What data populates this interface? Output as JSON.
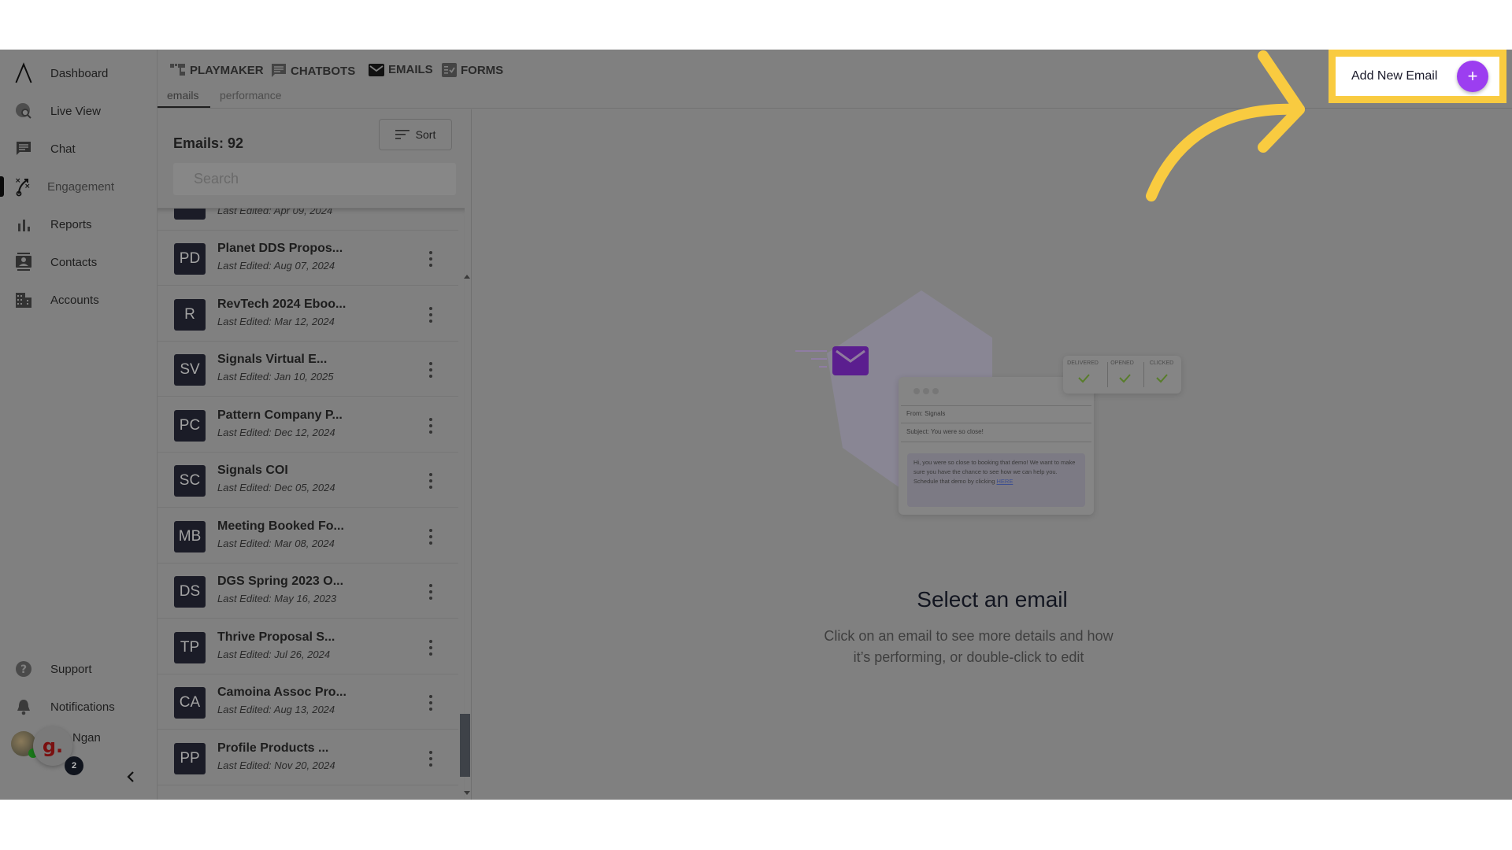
{
  "sidebar": {
    "items": [
      {
        "label": "Dashboard",
        "icon": "logo-icon"
      },
      {
        "label": "Live View",
        "icon": "globe-search-icon"
      },
      {
        "label": "Chat",
        "icon": "chat-icon"
      },
      {
        "label": "Engagement",
        "icon": "playbook-icon",
        "active": true
      },
      {
        "label": "Reports",
        "icon": "bar-chart-icon"
      },
      {
        "label": "Contacts",
        "icon": "contact-card-icon"
      },
      {
        "label": "Accounts",
        "icon": "building-icon"
      }
    ],
    "bottom_items": [
      {
        "label": "Support",
        "icon": "help-icon"
      },
      {
        "label": "Notifications",
        "icon": "bell-icon"
      }
    ],
    "user": {
      "name": "Ngan",
      "bubble_letter": "g.",
      "notification_count": "2"
    },
    "collapse_icon": "chevron-left-icon"
  },
  "topnav": {
    "tools": [
      {
        "label": "PLAYMAKER",
        "icon": "playmaker-icon"
      },
      {
        "label": "CHATBOTS",
        "icon": "chatbot-icon"
      },
      {
        "label": "EMAILS",
        "icon": "mail-icon",
        "active": true
      },
      {
        "label": "FORMS",
        "icon": "form-icon"
      }
    ],
    "subtabs": [
      {
        "label": "emails",
        "active": true
      },
      {
        "label": "performance"
      }
    ],
    "add_button": {
      "label": "Add New Email",
      "icon": "plus-icon"
    },
    "highlight_color": "#f9cb40",
    "accent_color": "#9c3ef0"
  },
  "email_list": {
    "count_label": "Emails: 92",
    "sort_label": "Sort",
    "search_placeholder": "Search",
    "partial_row": {
      "date": "Last Edited: Apr 09, 2024"
    },
    "items": [
      {
        "initials": "PD",
        "title": "Planet DDS Propos...",
        "date": "Last Edited: Aug 07, 2024"
      },
      {
        "initials": "R",
        "title": "RevTech 2024 Eboo...",
        "date": "Last Edited: Mar 12, 2024"
      },
      {
        "initials": "SV",
        "title": "Signals Virtual E...",
        "date": "Last Edited: Jan 10, 2025"
      },
      {
        "initials": "PC",
        "title": "Pattern Company P...",
        "date": "Last Edited: Dec 12, 2024"
      },
      {
        "initials": "SC",
        "title": "Signals COI",
        "date": "Last Edited: Dec 05, 2024"
      },
      {
        "initials": "MB",
        "title": "Meeting Booked Fo...",
        "date": "Last Edited: Mar 08, 2024"
      },
      {
        "initials": "DS",
        "title": "DGS Spring 2023 O...",
        "date": "Last Edited: May 16, 2023"
      },
      {
        "initials": "TP",
        "title": "Thrive Proposal S...",
        "date": "Last Edited: Jul 26, 2024"
      },
      {
        "initials": "CA",
        "title": "Camoina Assoc Pro...",
        "date": "Last Edited: Aug 13, 2024"
      },
      {
        "initials": "PP",
        "title": "Profile Products ...",
        "date": "Last Edited: Nov 20, 2024"
      }
    ]
  },
  "empty_state": {
    "title": "Select an email",
    "subtitle": "Click on an email to see more details and how it’s performing, or double-click to edit",
    "illustration": {
      "stats": [
        "DELIVERED",
        "OPENED",
        "CLICKED"
      ],
      "from": "From: Signals",
      "subject": "Subject: You were so close!",
      "body": "Hi, you were so close to booking that demo! We want to make sure you have the chance to see how we can help you. Schedule that demo by clicking",
      "link": "HERE"
    }
  }
}
